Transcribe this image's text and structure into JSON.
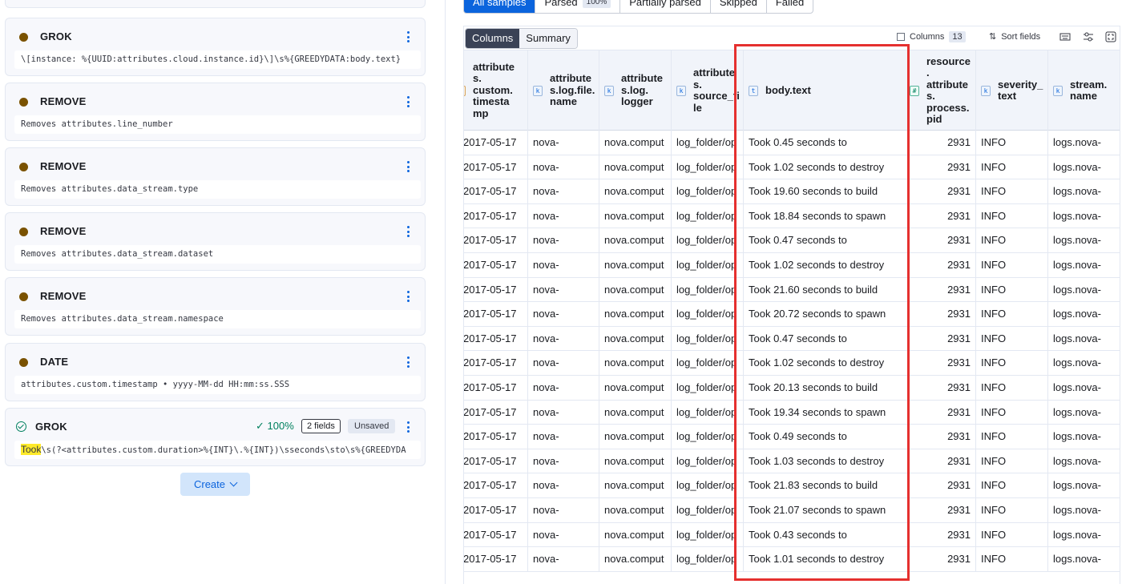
{
  "steps": [
    {
      "type": "GROK",
      "body": "\\[instance: %{UUID:attributes.cloud.instance.id}\\]\\s%{GREEDYDATA:body.text}"
    },
    {
      "type": "REMOVE",
      "body": "Removes attributes.line_number"
    },
    {
      "type": "REMOVE",
      "body": "Removes attributes.data_stream.type"
    },
    {
      "type": "REMOVE",
      "body": "Removes attributes.data_stream.dataset"
    },
    {
      "type": "REMOVE",
      "body": "Removes attributes.data_stream.namespace"
    },
    {
      "type": "DATE",
      "body": "attributes.custom.timestamp • yyyy-MM-dd HH:mm:ss.SSS"
    }
  ],
  "active_step": {
    "type": "GROK",
    "success_rate": "100%",
    "fields": "2 fields",
    "status": "Unsaved",
    "highlight": "Took",
    "body_rest": "\\s(?<attributes.custom.duration>%{INT}\\.%{INT})\\sseconds\\sto\\s%{GREEDYDA"
  },
  "create_button": "Create",
  "filters": {
    "all": "All samples",
    "parsed": "Parsed",
    "parsed_pct": "100%",
    "partial": "Partially parsed",
    "skipped": "Skipped",
    "failed": "Failed"
  },
  "toolbar": {
    "columns_tab": "Columns",
    "summary_tab": "Summary",
    "columns_label": "Columns",
    "columns_count": "13",
    "sort_label": "Sort fields"
  },
  "headers": [
    {
      "label": "attribute\ns.\ncustom.\ntimesta\nmp",
      "type": "date"
    },
    {
      "label": "attribute\ns.log.file.\nname",
      "type": "k"
    },
    {
      "label": "attribute\ns.log.\nlogger",
      "type": "k"
    },
    {
      "label": "attribute\ns.\nsource_fi\nle",
      "type": "k"
    },
    {
      "label": "body.text",
      "type": "t"
    },
    {
      "label": "resource\n.\nattribute\ns.\nprocess.\npid",
      "type": "#"
    },
    {
      "label": "severity_\ntext",
      "type": "k"
    },
    {
      "label": "stream.\nname",
      "type": "k"
    }
  ],
  "rows": [
    [
      "2017-05-17",
      "nova-",
      "nova.comput",
      "log_folder/op",
      "Took 0.45 seconds to",
      "2931",
      "INFO",
      "logs.nova-"
    ],
    [
      "2017-05-17",
      "nova-",
      "nova.comput",
      "log_folder/op",
      "Took 1.02 seconds to destroy",
      "2931",
      "INFO",
      "logs.nova-"
    ],
    [
      "2017-05-17",
      "nova-",
      "nova.comput",
      "log_folder/op",
      "Took 19.60 seconds to build",
      "2931",
      "INFO",
      "logs.nova-"
    ],
    [
      "2017-05-17",
      "nova-",
      "nova.comput",
      "log_folder/op",
      "Took 18.84 seconds to spawn",
      "2931",
      "INFO",
      "logs.nova-"
    ],
    [
      "2017-05-17",
      "nova-",
      "nova.comput",
      "log_folder/op",
      "Took 0.47 seconds to",
      "2931",
      "INFO",
      "logs.nova-"
    ],
    [
      "2017-05-17",
      "nova-",
      "nova.comput",
      "log_folder/op",
      "Took 1.02 seconds to destroy",
      "2931",
      "INFO",
      "logs.nova-"
    ],
    [
      "2017-05-17",
      "nova-",
      "nova.comput",
      "log_folder/op",
      "Took 21.60 seconds to build",
      "2931",
      "INFO",
      "logs.nova-"
    ],
    [
      "2017-05-17",
      "nova-",
      "nova.comput",
      "log_folder/op",
      "Took 20.72 seconds to spawn",
      "2931",
      "INFO",
      "logs.nova-"
    ],
    [
      "2017-05-17",
      "nova-",
      "nova.comput",
      "log_folder/op",
      "Took 0.47 seconds to",
      "2931",
      "INFO",
      "logs.nova-"
    ],
    [
      "2017-05-17",
      "nova-",
      "nova.comput",
      "log_folder/op",
      "Took 1.02 seconds to destroy",
      "2931",
      "INFO",
      "logs.nova-"
    ],
    [
      "2017-05-17",
      "nova-",
      "nova.comput",
      "log_folder/op",
      "Took 20.13 seconds to build",
      "2931",
      "INFO",
      "logs.nova-"
    ],
    [
      "2017-05-17",
      "nova-",
      "nova.comput",
      "log_folder/op",
      "Took 19.34 seconds to spawn",
      "2931",
      "INFO",
      "logs.nova-"
    ],
    [
      "2017-05-17",
      "nova-",
      "nova.comput",
      "log_folder/op",
      "Took 0.49 seconds to",
      "2931",
      "INFO",
      "logs.nova-"
    ],
    [
      "2017-05-17",
      "nova-",
      "nova.comput",
      "log_folder/op",
      "Took 1.03 seconds to destroy",
      "2931",
      "INFO",
      "logs.nova-"
    ],
    [
      "2017-05-17",
      "nova-",
      "nova.comput",
      "log_folder/op",
      "Took 21.83 seconds to build",
      "2931",
      "INFO",
      "logs.nova-"
    ],
    [
      "2017-05-17",
      "nova-",
      "nova.comput",
      "log_folder/op",
      "Took 21.07 seconds to spawn",
      "2931",
      "INFO",
      "logs.nova-"
    ],
    [
      "2017-05-17",
      "nova-",
      "nova.comput",
      "log_folder/op",
      "Took 0.43 seconds to",
      "2931",
      "INFO",
      "logs.nova-"
    ],
    [
      "2017-05-17",
      "nova-",
      "nova.comput",
      "log_folder/op",
      "Took 1.01 seconds to destroy",
      "2931",
      "INFO",
      "logs.nova-"
    ]
  ],
  "colors": {
    "accent": "#0b64dd",
    "success": "#00805e",
    "highlight_box": "#e5302f",
    "step_dot": "#7a5200"
  }
}
